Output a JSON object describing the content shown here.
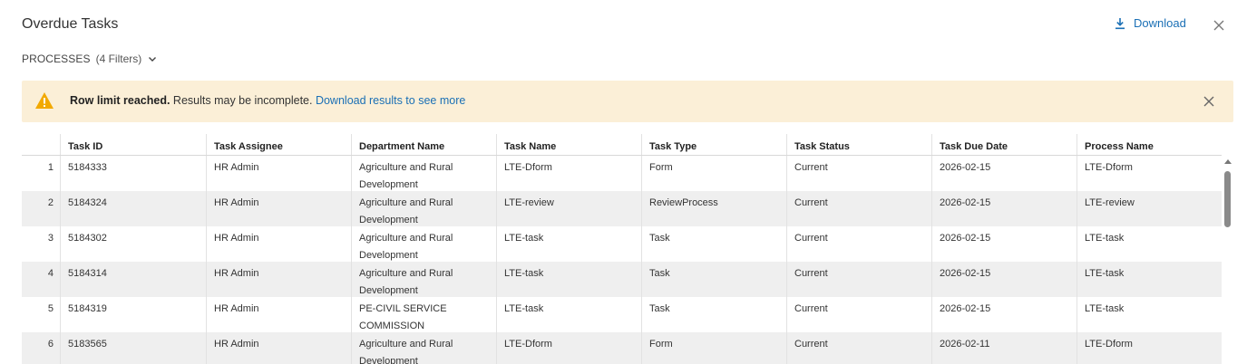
{
  "header": {
    "title": "Overdue Tasks",
    "download_label": "Download"
  },
  "filters": {
    "label": "PROCESSES",
    "count": "(4 Filters)"
  },
  "banner": {
    "bold_text": "Row limit reached.",
    "text": " Results may be incomplete. ",
    "link_text": "Download results to see more"
  },
  "table": {
    "columns": [
      "",
      "Task ID",
      "Task Assignee",
      "Department Name",
      "Task Name",
      "Task Type",
      "Task Status",
      "Task Due Date",
      "Process Name"
    ],
    "rows": [
      [
        "1",
        "5184333",
        "HR Admin",
        "Agriculture and Rural Development",
        "LTE-Dform",
        "Form",
        "Current",
        "2026-02-15",
        "LTE-Dform"
      ],
      [
        "2",
        "5184324",
        "HR Admin",
        "Agriculture and Rural Development",
        "LTE-review",
        "ReviewProcess",
        "Current",
        "2026-02-15",
        "LTE-review"
      ],
      [
        "3",
        "5184302",
        "HR Admin",
        "Agriculture and Rural Development",
        "LTE-task",
        "Task",
        "Current",
        "2026-02-15",
        "LTE-task"
      ],
      [
        "4",
        "5184314",
        "HR Admin",
        "Agriculture and Rural Development",
        "LTE-task",
        "Task",
        "Current",
        "2026-02-15",
        "LTE-task"
      ],
      [
        "5",
        "5184319",
        "HR Admin",
        "PE-CIVIL SERVICE COMMISSION",
        "LTE-task",
        "Task",
        "Current",
        "2026-02-15",
        "LTE-task"
      ],
      [
        "6",
        "5183565",
        "HR Admin",
        "Agriculture and Rural Development",
        "LTE-Dform",
        "Form",
        "Current",
        "2026-02-11",
        "LTE-Dform"
      ]
    ]
  },
  "colors": {
    "accent": "#1a6fb5",
    "banner_bg": "#fbefd7",
    "warning": "#f2a900"
  },
  "icons": {
    "download": "download-icon",
    "close": "close-icon",
    "warning": "warning-icon",
    "chevron": "chevron-down-icon"
  }
}
